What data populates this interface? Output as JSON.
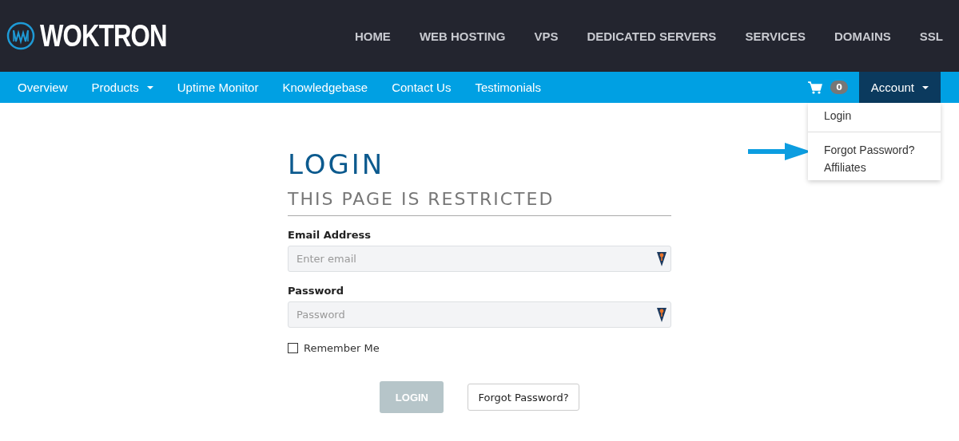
{
  "brand": {
    "name": "WOKTRON"
  },
  "main_nav": [
    "HOME",
    "WEB HOSTING",
    "VPS",
    "DEDICATED SERVERS",
    "SERVICES",
    "DOMAINS",
    "SSL"
  ],
  "sub_nav": [
    {
      "label": "Overview",
      "dropdown": false
    },
    {
      "label": "Products",
      "dropdown": true
    },
    {
      "label": "Uptime Monitor",
      "dropdown": false
    },
    {
      "label": "Knowledgebase",
      "dropdown": false
    },
    {
      "label": "Contact Us",
      "dropdown": false
    },
    {
      "label": "Testimonials",
      "dropdown": false
    }
  ],
  "cart": {
    "count": "0"
  },
  "account_menu": {
    "label": "Account",
    "expanded": true,
    "items": [
      {
        "label": "Login",
        "divider_after": true
      },
      {
        "label": "Forgot Password?",
        "divider_after": false
      },
      {
        "label": "Affiliates",
        "divider_after": false
      }
    ]
  },
  "login": {
    "title": "LOGIN",
    "subtitle": "THIS PAGE IS RESTRICTED",
    "fields": [
      {
        "label": "Email Address",
        "placeholder": "Enter email"
      },
      {
        "label": "Password",
        "placeholder": "Password"
      }
    ],
    "remember": {
      "label": "Remember Me",
      "checked": false
    },
    "submit": {
      "label": "LOGIN",
      "disabled": true
    },
    "forgot": {
      "label": "Forgot Password?"
    }
  }
}
